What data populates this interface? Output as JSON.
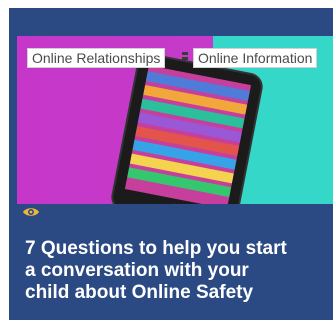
{
  "card": {
    "tags": [
      "Online Relationships",
      "Online Information"
    ],
    "views_icon": "eye-icon",
    "title_lines": [
      "7 Questions to help you start",
      "a conversation with your",
      "child about Online Safety"
    ]
  },
  "colors": {
    "card_background": "#2b4a83",
    "thumb_left": "#c637c9",
    "thumb_right": "#35d7c8",
    "eye_icon": "#f2b53a",
    "title_text": "#ffffff"
  }
}
